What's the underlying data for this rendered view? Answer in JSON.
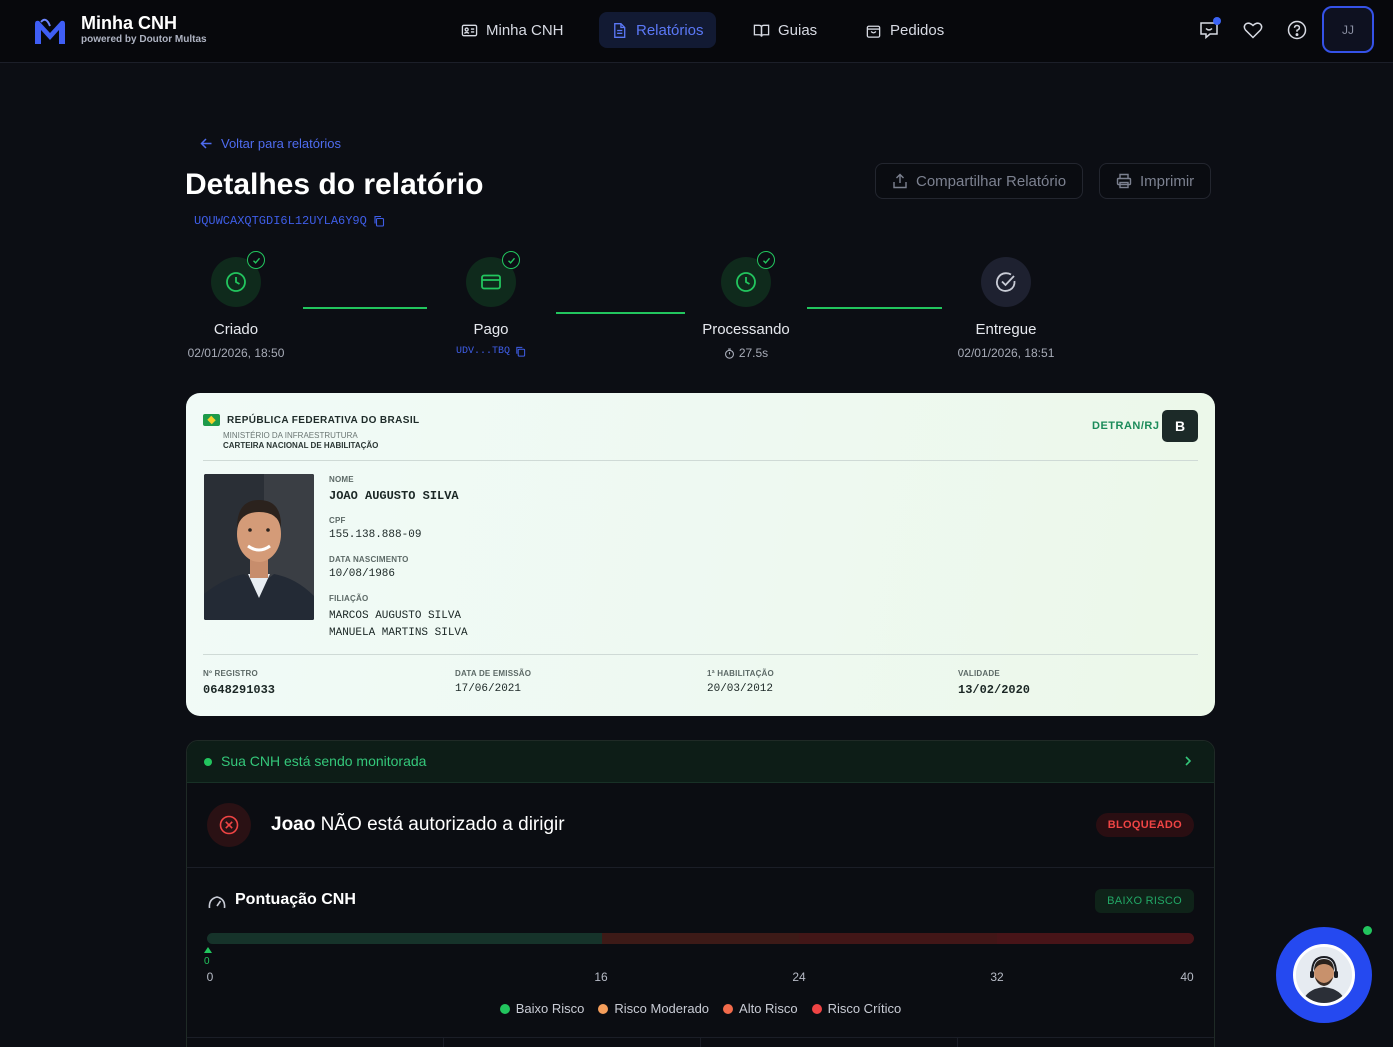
{
  "brand": {
    "name": "Minha CNH",
    "tagline": "powered by Doutor Multas"
  },
  "nav": {
    "items": [
      {
        "label": "Minha CNH",
        "icon": "id-card-icon",
        "active": false
      },
      {
        "label": "Relatórios",
        "icon": "document-icon",
        "active": true
      },
      {
        "label": "Guias",
        "icon": "book-icon",
        "active": false
      },
      {
        "label": "Pedidos",
        "icon": "shopping-bag-icon",
        "active": false
      }
    ],
    "user_initials": "JJ"
  },
  "header": {
    "back_label": "Voltar para relatórios",
    "title": "Detalhes do relatório",
    "report_id": "UQUWCAXQTGDI6L12UYLA6Y9Q",
    "share_label": "Compartilhar Relatório",
    "print_label": "Imprimir"
  },
  "steps": [
    {
      "label": "Criado",
      "sub": "02/01/2026, 18:50"
    },
    {
      "label": "Pago",
      "sub": "UDV...TBQ"
    },
    {
      "label": "Processando",
      "sub": "27.5s"
    },
    {
      "label": "Entregue",
      "sub": "02/01/2026, 18:51"
    }
  ],
  "license": {
    "country": "REPÚBLICA FEDERATIVA DO BRASIL",
    "ministry": "MINISTÉRIO DA INFRAESTRUTURA",
    "doc_type": "CARTEIRA NACIONAL DE HABILITAÇÃO",
    "issuer": "DETRAN/RJ",
    "category": "B",
    "name_label": "NOME",
    "name": "JOAO AUGUSTO SILVA",
    "cpf_label": "CPF",
    "cpf": "155.138.888-09",
    "birth_label": "DATA NASCIMENTO",
    "birth": "10/08/1986",
    "parents_label": "FILIAÇÃO",
    "father": "MARCOS AUGUSTO SILVA",
    "mother": "MANUELA MARTINS SILVA",
    "registry_label": "Nº REGISTRO",
    "registry": "0648291033",
    "issue_label": "DATA DE EMISSÃO",
    "issue": "17/06/2021",
    "first_license_label": "1ª HABILITAÇÃO",
    "first_license": "20/03/2012",
    "validity_label": "VALIDADE",
    "validity": "13/02/2020"
  },
  "monitor": {
    "status_text": "Sua CNH está sendo monitorada",
    "driver_name": "Joao",
    "authorization_text": "NÃO está autorizado a dirigir",
    "block_badge": "BLOQUEADO",
    "score_title": "Pontuação CNH",
    "risk_badge": "BAIXO RISCO",
    "score_value": "0",
    "score_max": 40,
    "ticks": [
      "0",
      "16",
      "24",
      "32",
      "40"
    ],
    "legend": [
      {
        "label": "Baixo Risco",
        "color": "#22c55e"
      },
      {
        "label": "Risco Moderado",
        "color": "#f59e5b"
      },
      {
        "label": "Alto Risco",
        "color": "#f26b4b"
      },
      {
        "label": "Risco Crítico",
        "color": "#ef4444"
      }
    ]
  },
  "colors": {
    "accent": "#3b63f5",
    "success": "#22c55e",
    "danger": "#ef4444"
  }
}
